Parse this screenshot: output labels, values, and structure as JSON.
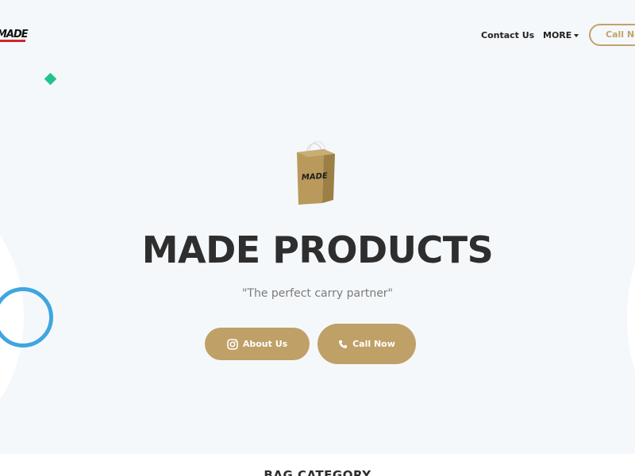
{
  "brand": {
    "logo_text": "MADE"
  },
  "nav": {
    "contact_label": "Contact Us",
    "more_label": "MORE",
    "call_label": "Call Now"
  },
  "hero": {
    "bag_logo_text": "MADE",
    "title": "MADE PRODUCTS",
    "tagline": "\"The perfect carry partner\"",
    "about_button": {
      "label": "About Us",
      "icon": "instagram-icon"
    },
    "call_button": {
      "label": "Call Now",
      "icon": "phone-icon"
    }
  },
  "next_section": {
    "heading": "BAG CATEGORY"
  },
  "colors": {
    "accent_gold": "#bfa066",
    "hero_bg": "#f5f8fb",
    "ring_blue": "#3ea6e0",
    "diamond_green": "#22c38a",
    "logo_red": "#d0262c"
  }
}
